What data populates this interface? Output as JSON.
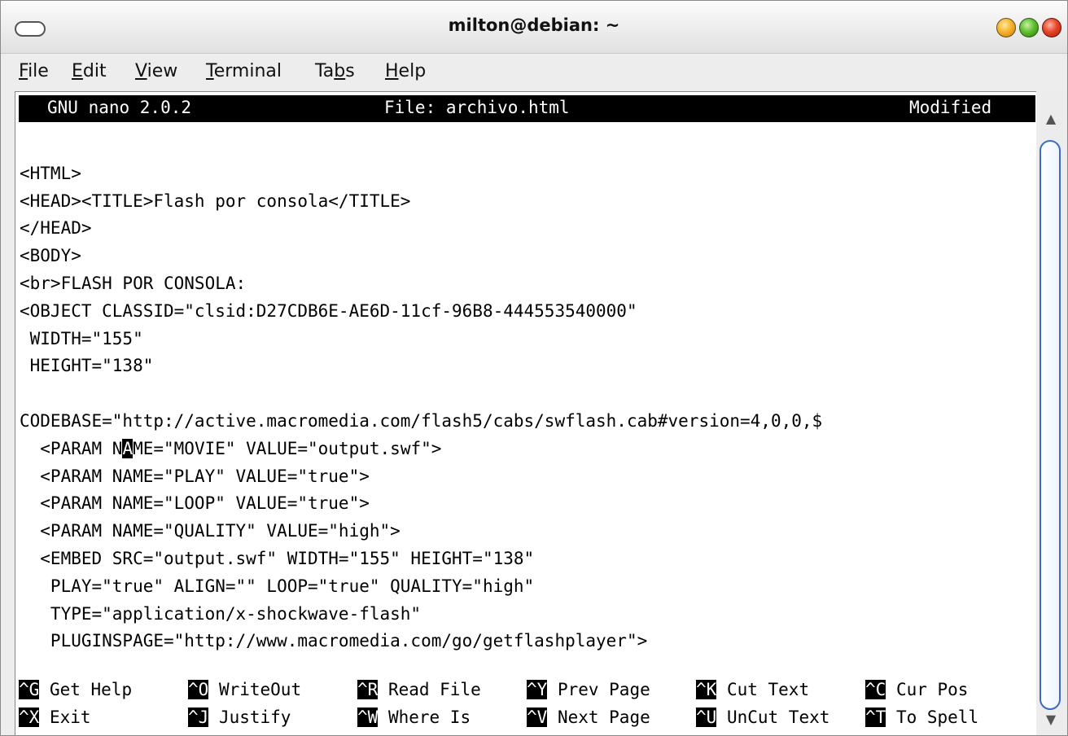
{
  "window": {
    "title": "milton@debian: ~"
  },
  "menu": [
    "File",
    "Edit",
    "View",
    "Terminal",
    "Tabs",
    "Help"
  ],
  "menu_mnemonic_index": [
    0,
    0,
    0,
    0,
    2,
    0
  ],
  "nano": {
    "version": "GNU nano 2.0.2",
    "file": "File: archivo.html",
    "status": "Modified"
  },
  "code_lines": [
    "",
    "<HTML>",
    "<HEAD><TITLE>Flash por consola</TITLE>",
    "</HEAD>",
    "<BODY>",
    "<br>FLASH POR CONSOLA:",
    "<OBJECT CLASSID=\"clsid:D27CDB6E-AE6D-11cf-96B8-444553540000\"",
    " WIDTH=\"155\"",
    " HEIGHT=\"138\"",
    "",
    "CODEBASE=\"http://active.macromedia.com/flash5/cabs/swflash.cab#version=4,0,0,$",
    "  <PARAM NAME=\"MOVIE\" VALUE=\"output.swf\">",
    "  <PARAM NAME=\"PLAY\" VALUE=\"true\">",
    "  <PARAM NAME=\"LOOP\" VALUE=\"true\">",
    "  <PARAM NAME=\"QUALITY\" VALUE=\"high\">",
    "  <EMBED SRC=\"output.swf\" WIDTH=\"155\" HEIGHT=\"138\"",
    "   PLAY=\"true\" ALIGN=\"\" LOOP=\"true\" QUALITY=\"high\"",
    "   TYPE=\"application/x-shockwave-flash\"",
    "   PLUGINSPAGE=\"http://www.macromedia.com/go/getflashplayer\">",
    ""
  ],
  "cursor": {
    "line": 11,
    "col": 10
  },
  "shortcuts": [
    [
      {
        "key": "^G",
        "label": "Get Help"
      },
      {
        "key": "^O",
        "label": "WriteOut"
      },
      {
        "key": "^R",
        "label": "Read File"
      },
      {
        "key": "^Y",
        "label": "Prev Page"
      },
      {
        "key": "^K",
        "label": "Cut Text"
      },
      {
        "key": "^C",
        "label": "Cur Pos"
      }
    ],
    [
      {
        "key": "^X",
        "label": "Exit"
      },
      {
        "key": "^J",
        "label": "Justify"
      },
      {
        "key": "^W",
        "label": "Where Is"
      },
      {
        "key": "^V",
        "label": "Next Page"
      },
      {
        "key": "^U",
        "label": "UnCut Text"
      },
      {
        "key": "^T",
        "label": "To Spell"
      }
    ]
  ],
  "scrollbar": {
    "up_icon": "▲",
    "down_icon": "▼"
  },
  "colors": {
    "minimize": "#f6b42b",
    "maximize": "#5fbf2e",
    "close": "#e64528",
    "scroll_thumb": "#3b6cc2"
  }
}
